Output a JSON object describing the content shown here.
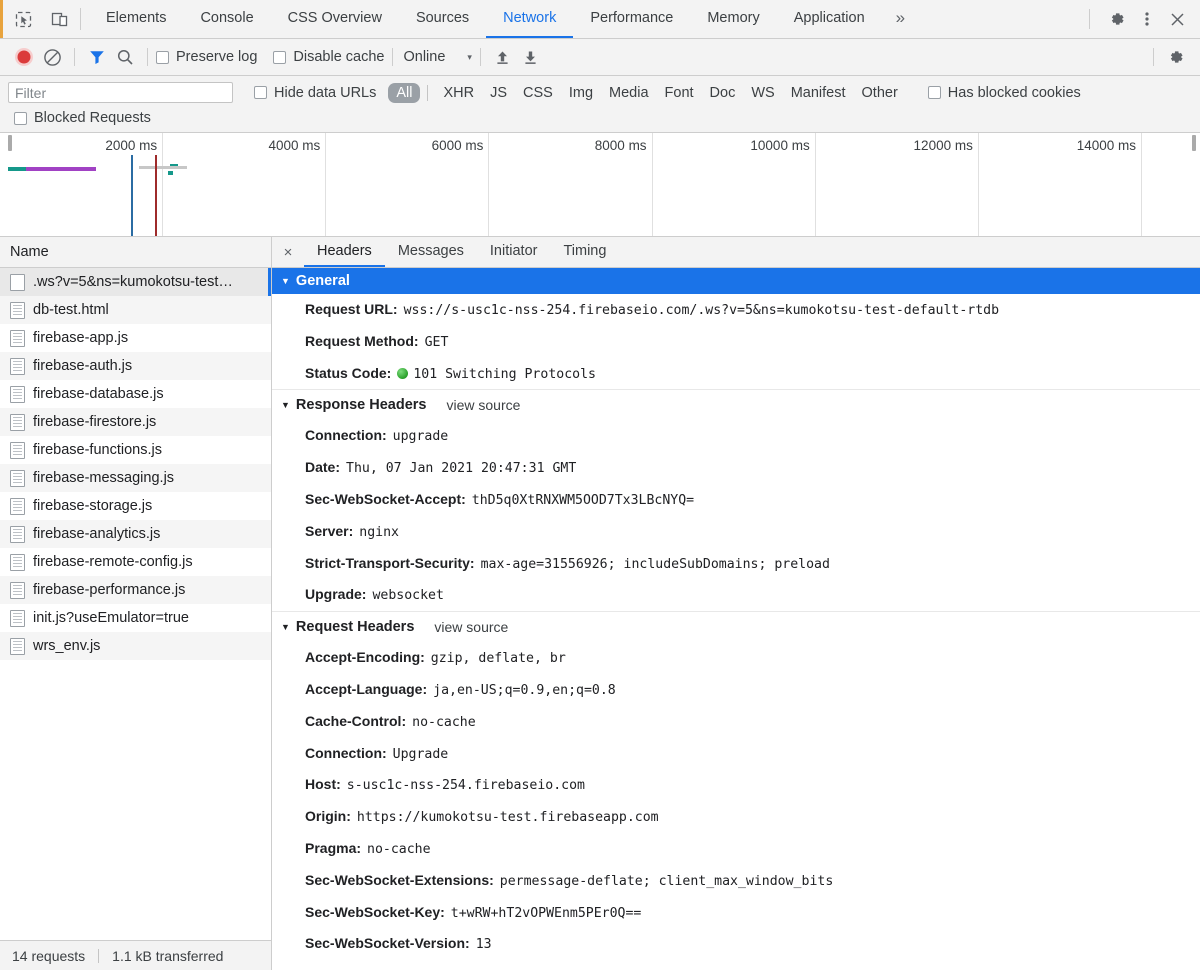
{
  "tabbar": {
    "icons": [
      {
        "name": "inspect-element-icon"
      },
      {
        "name": "device-toolbar-icon"
      }
    ],
    "tabs": [
      {
        "label": "Elements",
        "active": false
      },
      {
        "label": "Console",
        "active": false
      },
      {
        "label": "CSS Overview",
        "active": false
      },
      {
        "label": "Sources",
        "active": false
      },
      {
        "label": "Network",
        "active": true
      },
      {
        "label": "Performance",
        "active": false
      },
      {
        "label": "Memory",
        "active": false
      },
      {
        "label": "Application",
        "active": false
      }
    ],
    "more_label": "»",
    "right_icons": [
      {
        "name": "settings-gear-icon"
      },
      {
        "name": "more-vertical-icon"
      },
      {
        "name": "close-devtools-icon"
      }
    ]
  },
  "nettoolbar": {
    "record_title": "record-button",
    "clear_title": "clear-button",
    "filter_title": "filter-toggle",
    "search_title": "search-button",
    "preserve_log_label": "Preserve log",
    "disable_cache_label": "Disable cache",
    "throttle_value": "Online",
    "caret": "▾",
    "import_title": "import-har",
    "export_title": "export-har",
    "settings_title": "network-settings-gear"
  },
  "filterbar": {
    "filter_placeholder": "Filter",
    "filter_value": "",
    "hide_data_urls_label": "Hide data URLs",
    "types": [
      {
        "label": "All",
        "active": true
      },
      {
        "label": "XHR",
        "active": false
      },
      {
        "label": "JS",
        "active": false
      },
      {
        "label": "CSS",
        "active": false
      },
      {
        "label": "Img",
        "active": false
      },
      {
        "label": "Media",
        "active": false
      },
      {
        "label": "Font",
        "active": false
      },
      {
        "label": "Doc",
        "active": false
      },
      {
        "label": "WS",
        "active": false
      },
      {
        "label": "Manifest",
        "active": false
      },
      {
        "label": "Other",
        "active": false
      }
    ],
    "has_blocked_cookies_label": "Has blocked cookies",
    "blocked_requests_label": "Blocked Requests"
  },
  "overview": {
    "ticks": [
      "2000 ms",
      "4000 ms",
      "6000 ms",
      "8000 ms",
      "10000 ms",
      "12000 ms",
      "14000 ms"
    ],
    "colors": {
      "dom_content_loaded": "#2b6ca3",
      "load": "#9e2b2b",
      "request_teal": "#15988a",
      "request_purple": "#a142c4",
      "request_gray": "#c7c7c7"
    }
  },
  "requests": {
    "column_header": "Name",
    "rows": [
      {
        "name": ".ws?v=5&ns=kumokotsu-test…",
        "icon": "websocket-icon",
        "selected": true
      },
      {
        "name": "db-test.html",
        "icon": "document-icon",
        "selected": false
      },
      {
        "name": "firebase-app.js",
        "icon": "document-icon",
        "selected": false
      },
      {
        "name": "firebase-auth.js",
        "icon": "document-icon",
        "selected": false
      },
      {
        "name": "firebase-database.js",
        "icon": "document-icon",
        "selected": false
      },
      {
        "name": "firebase-firestore.js",
        "icon": "document-icon",
        "selected": false
      },
      {
        "name": "firebase-functions.js",
        "icon": "document-icon",
        "selected": false
      },
      {
        "name": "firebase-messaging.js",
        "icon": "document-icon",
        "selected": false
      },
      {
        "name": "firebase-storage.js",
        "icon": "document-icon",
        "selected": false
      },
      {
        "name": "firebase-analytics.js",
        "icon": "document-icon",
        "selected": false
      },
      {
        "name": "firebase-remote-config.js",
        "icon": "document-icon",
        "selected": false
      },
      {
        "name": "firebase-performance.js",
        "icon": "document-icon",
        "selected": false
      },
      {
        "name": "init.js?useEmulator=true",
        "icon": "document-icon",
        "selected": false
      },
      {
        "name": "wrs_env.js",
        "icon": "document-icon",
        "selected": false
      }
    ],
    "footer": {
      "request_count": "14 requests",
      "transferred": "1.1 kB transferred"
    }
  },
  "detail": {
    "close_label": "×",
    "tabs": [
      {
        "label": "Headers",
        "active": true
      },
      {
        "label": "Messages",
        "active": false
      },
      {
        "label": "Initiator",
        "active": false
      },
      {
        "label": "Timing",
        "active": false
      }
    ],
    "sections": [
      {
        "title": "General",
        "highlight": true,
        "view_source": null,
        "rows": [
          {
            "name": "Request URL:",
            "value": "wss://s-usc1c-nss-254.firebaseio.com/.ws?v=5&ns=kumokotsu-test-default-rtdb"
          },
          {
            "name": "Request Method:",
            "value": "GET"
          },
          {
            "name": "Status Code:",
            "value": "101 Switching Protocols",
            "status_dot": true
          }
        ]
      },
      {
        "title": "Response Headers",
        "highlight": false,
        "view_source": "view source",
        "rows": [
          {
            "name": "Connection:",
            "value": "upgrade"
          },
          {
            "name": "Date:",
            "value": "Thu, 07 Jan 2021 20:47:31 GMT"
          },
          {
            "name": "Sec-WebSocket-Accept:",
            "value": "thD5q0XtRNXWM5OOD7Tx3LBcNYQ="
          },
          {
            "name": "Server:",
            "value": "nginx"
          },
          {
            "name": "Strict-Transport-Security:",
            "value": "max-age=31556926; includeSubDomains; preload"
          },
          {
            "name": "Upgrade:",
            "value": "websocket"
          }
        ]
      },
      {
        "title": "Request Headers",
        "highlight": false,
        "view_source": "view source",
        "rows": [
          {
            "name": "Accept-Encoding:",
            "value": "gzip, deflate, br"
          },
          {
            "name": "Accept-Language:",
            "value": "ja,en-US;q=0.9,en;q=0.8"
          },
          {
            "name": "Cache-Control:",
            "value": "no-cache"
          },
          {
            "name": "Connection:",
            "value": "Upgrade"
          },
          {
            "name": "Host:",
            "value": "s-usc1c-nss-254.firebaseio.com"
          },
          {
            "name": "Origin:",
            "value": "https://kumokotsu-test.firebaseapp.com"
          },
          {
            "name": "Pragma:",
            "value": "no-cache"
          },
          {
            "name": "Sec-WebSocket-Extensions:",
            "value": "permessage-deflate; client_max_window_bits"
          },
          {
            "name": "Sec-WebSocket-Key:",
            "value": "t+wRW+hT2vOPWEnm5PEr0Q=="
          },
          {
            "name": "Sec-WebSocket-Version:",
            "value": "13"
          }
        ]
      }
    ]
  }
}
